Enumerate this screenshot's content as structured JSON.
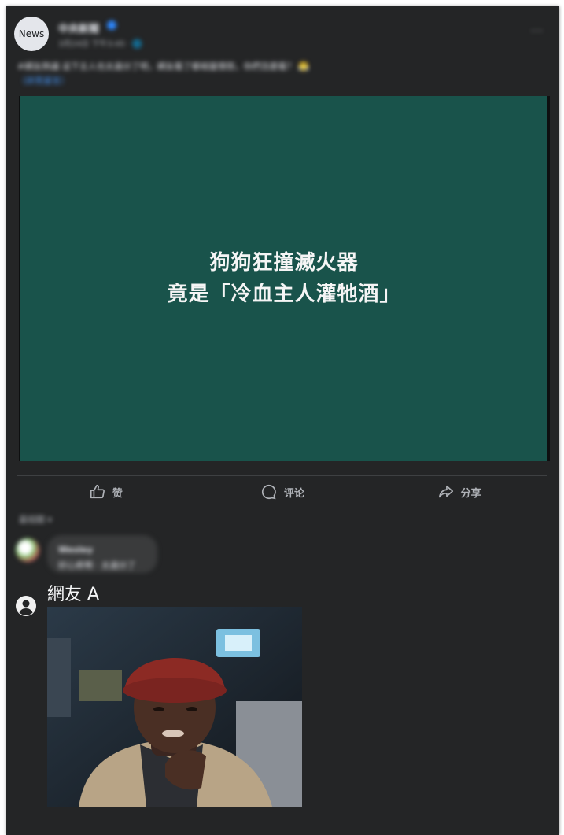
{
  "post": {
    "avatar_label": "News",
    "page_name": "中央新聞",
    "time": "3月24日 下午3:45 · 🌐",
    "more": "···",
    "caption_line1": "#網友熱議 這下主人也太過分了吧，網友看了都相當憤怒，你們怎麼看？ 😤",
    "caption_line2": "（詳見留言）"
  },
  "video": {
    "line1": "狗狗狂撞滅火器",
    "line2": "竟是「冷血主人灌牠酒」"
  },
  "actions": {
    "like": "赞",
    "comment": "评论",
    "share": "分享"
  },
  "comments": {
    "sort": "最相關 ▾",
    "c1_name": "Wesley",
    "c1_text": "好心疼啊 · 太過分了",
    "c2_name": "網友 A"
  },
  "colors": {
    "card_bg": "#242526",
    "video_bg": "#19534b",
    "text_primary": "#e4e6eb",
    "text_secondary": "#b0b3b8",
    "link": "#4599ff"
  },
  "icons": [
    "like-icon",
    "comment-icon",
    "share-icon",
    "user-icon",
    "more-icon",
    "verified-icon"
  ]
}
